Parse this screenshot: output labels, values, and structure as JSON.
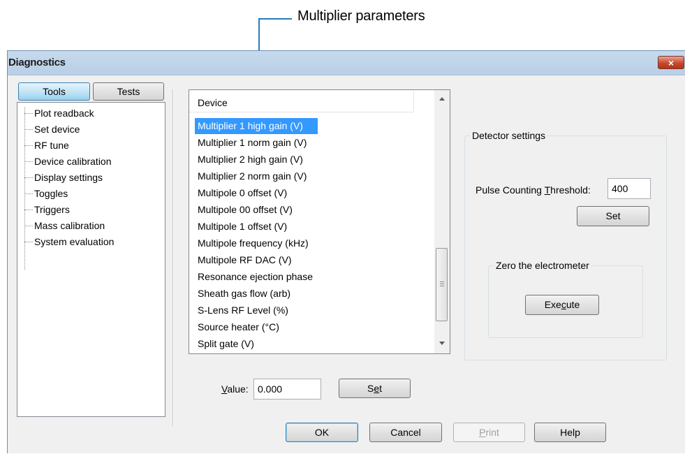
{
  "callout": {
    "label": "Multiplier parameters"
  },
  "dialog": {
    "title": "Diagnostics",
    "close_glyph": "×"
  },
  "tabs": {
    "tools": "Tools",
    "tests": "Tests"
  },
  "tree_items": [
    "Plot readback",
    "Set device",
    "RF tune",
    "Device calibration",
    "Display settings",
    "Toggles",
    "Triggers",
    "Mass calibration",
    "System evaluation"
  ],
  "device_list": {
    "header": "Device",
    "selected_index": 0,
    "items": [
      "Multiplier 1 high gain (V)",
      "Multiplier 1 norm gain (V)",
      "Multiplier 2 high gain (V)",
      "Multiplier 2 norm gain (V)",
      "Multipole 0 offset (V)",
      "Multipole 00 offset (V)",
      "Multipole 1 offset (V)",
      "Multipole frequency (kHz)",
      "Multipole RF DAC (V)",
      "Resonance ejection phase",
      "Sheath gas flow (arb)",
      "S-Lens RF Level (%)",
      "Source heater (°C)",
      "Split gate (V)"
    ]
  },
  "value_row": {
    "label_pre": "",
    "label_mnemonic": "V",
    "label_post": "alue:",
    "value": "0.000",
    "set_pre": "S",
    "set_mnemonic": "e",
    "set_post": "t"
  },
  "detector": {
    "caption": "Detector settings",
    "threshold_pre": "Pulse Counting ",
    "threshold_mnemonic": "T",
    "threshold_post": "hreshold:",
    "threshold_value": "400",
    "set_label": "Set",
    "zero_caption": "Zero the electrometer",
    "execute_pre": "Exe",
    "execute_mnemonic": "c",
    "execute_post": "ute"
  },
  "footer": {
    "ok": "OK",
    "cancel": "Cancel",
    "print_mnemonic": "P",
    "print_post": "rint",
    "help": "Help"
  }
}
